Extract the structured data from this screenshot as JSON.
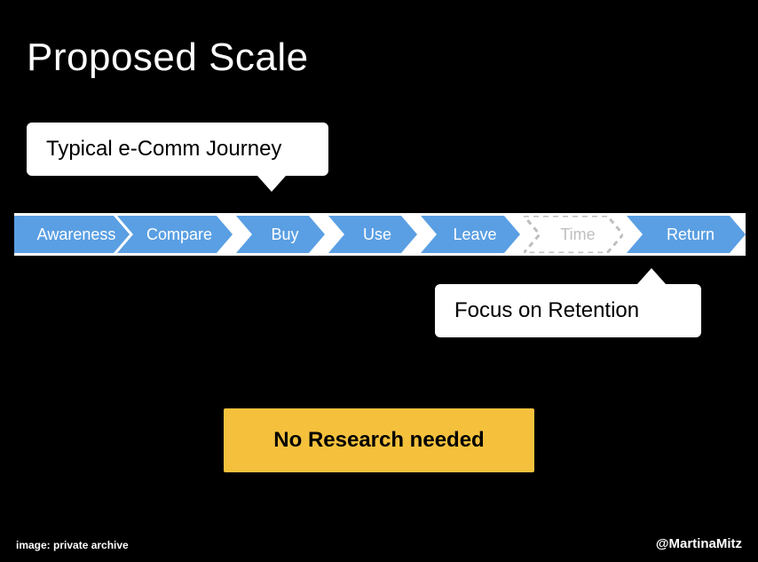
{
  "title": "Proposed Scale",
  "callout_top": "Typical e-Comm Journey",
  "callout_bottom": "Focus on Retention",
  "highlight": "No Research needed",
  "credit": "image: private archive",
  "handle": "@MartinaMitz",
  "steps": {
    "s0": "Awareness",
    "s1": "Compare",
    "s2": "Buy",
    "s3": "Use",
    "s4": "Leave",
    "s5": "Time",
    "s6": "Return"
  },
  "colors": {
    "accent": "#5a9fe3",
    "highlight": "#f5c13d",
    "muted": "#bfbfbf"
  }
}
